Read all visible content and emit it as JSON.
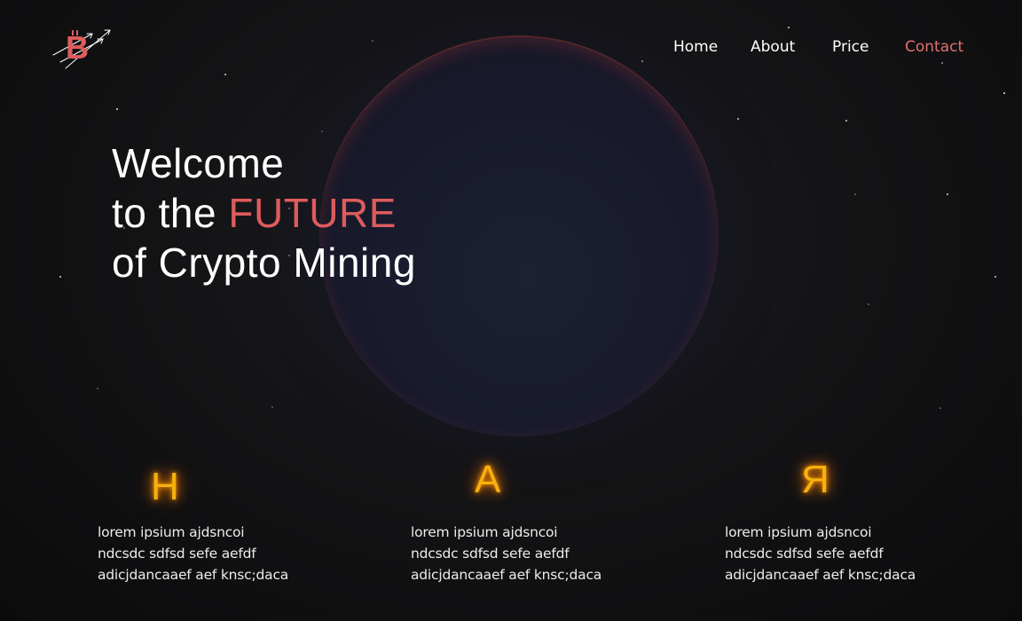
{
  "brand": {
    "logo_icon": "bitcoin-growth-icon",
    "accent_color": "#de5c5c"
  },
  "nav": {
    "items": [
      {
        "label": "Home",
        "active": false
      },
      {
        "label": "About",
        "active": false
      },
      {
        "label": "Price",
        "active": false
      },
      {
        "label": "Contact",
        "active": true
      }
    ]
  },
  "hero": {
    "line1": "Welcome",
    "line2_prefix": "to the ",
    "line2_accent": "FUTURE",
    "line3": "of Crypto Mining"
  },
  "features": [
    {
      "glyph": "H",
      "text": "lorem ipsium ajdsncoi ndcsdc sdfsd sefe aefdf adicjdancaaef aef knsc;daca"
    },
    {
      "glyph": "A",
      "text": "lorem ipsium ajdsncoi ndcsdc sdfsd sefe aefdf adicjdancaaef aef knsc;daca"
    },
    {
      "glyph": "Я",
      "text": "lorem ipsium ajdsncoi ndcsdc sdfsd sefe aefdf adicjdancaaef aef knsc;daca"
    }
  ],
  "colors": {
    "glyph_glow": "#f6b10e",
    "contact_link": "#e0706c",
    "background": "#121214"
  }
}
